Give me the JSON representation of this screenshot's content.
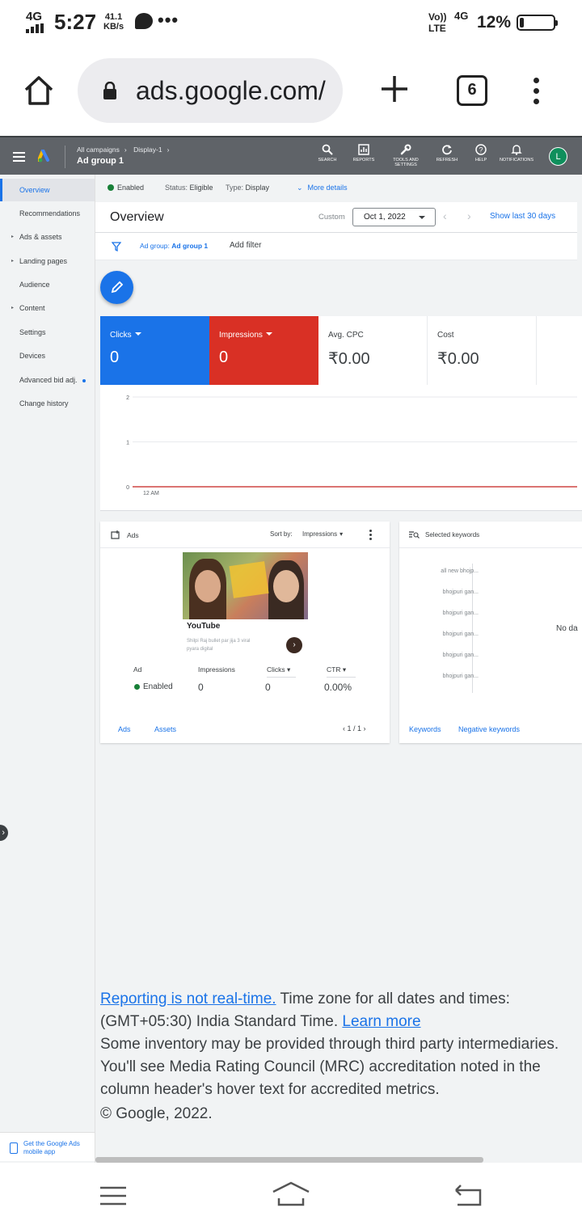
{
  "status_bar": {
    "network": "4G",
    "time": "5:27",
    "speed_value": "41.1",
    "speed_unit": "KB/s",
    "overflow_icon": "more-dots-icon",
    "volte": "Vo))",
    "lte": "LTE",
    "network2": "4G",
    "battery": "12%"
  },
  "browser": {
    "url": "ads.google.com/",
    "tab_count": "6"
  },
  "header": {
    "breadcrumb": [
      "All campaigns",
      "Display-1"
    ],
    "title": "Ad group 1",
    "icons": [
      {
        "label": "SEARCH",
        "icon": "search-icon"
      },
      {
        "label": "REPORTS",
        "icon": "reports-icon"
      },
      {
        "label": "TOOLS AND SETTINGS",
        "icon": "tools-icon"
      },
      {
        "label": "REFRESH",
        "icon": "refresh-icon"
      },
      {
        "label": "HELP",
        "icon": "help-icon"
      },
      {
        "label": "NOTIFICATIONS",
        "icon": "bell-icon"
      }
    ],
    "avatar": "L"
  },
  "nav": {
    "items": [
      {
        "label": "Overview"
      },
      {
        "label": "Recommendations"
      },
      {
        "label": "Ads & assets"
      },
      {
        "label": "Landing pages"
      },
      {
        "label": "Audience"
      },
      {
        "label": "Content"
      },
      {
        "label": "Settings"
      },
      {
        "label": "Devices"
      },
      {
        "label": "Advanced bid adj."
      },
      {
        "label": "Change history"
      }
    ],
    "get_app": "Get the Google Ads mobile app"
  },
  "status_row": {
    "enabled": "Enabled",
    "status_label": "Status:",
    "status_value": "Eligible",
    "type_label": "Type:",
    "type_value": "Display",
    "more_details": "More details"
  },
  "overview": {
    "title": "Overview",
    "custom": "Custom",
    "date": "Oct 1, 2022",
    "show_last": "Show last 30 days"
  },
  "filter": {
    "tag_label": "Ad group:",
    "tag_value": "Ad group 1",
    "add_filter": "Add filter"
  },
  "metrics": [
    {
      "label": "Clicks",
      "value": "0"
    },
    {
      "label": "Impressions",
      "value": "0"
    },
    {
      "label": "Avg. CPC",
      "value": "₹0.00"
    },
    {
      "label": "Cost",
      "value": "₹0.00"
    }
  ],
  "chart_data": {
    "type": "line",
    "x": [
      "12 AM"
    ],
    "series": [
      {
        "values": [
          0
        ]
      }
    ],
    "ylim": [
      0,
      2
    ],
    "yticks": [
      "2",
      "1",
      "0"
    ],
    "line_color": "#c5221f"
  },
  "ads_card": {
    "title": "Ads",
    "sort_by": "Sort by:",
    "sort_value": "Impressions",
    "ad_brand": "YouTube",
    "ad_line1": "Shilpi Raj bullet par jija 3 viral",
    "ad_line2": "pyara digital",
    "columns": [
      "Ad",
      "Impressions",
      "Clicks",
      "CTR"
    ],
    "row": {
      "status": "Enabled",
      "impressions": "0",
      "clicks": "0",
      "ctr": "0.00%"
    },
    "link_ads": "Ads",
    "link_assets": "Assets",
    "pagination": "1 / 1"
  },
  "keywords_card": {
    "title": "Selected keywords",
    "keywords": [
      "all new bhojp...",
      "bhojpuri gan...",
      "bhojpuri gan...",
      "bhojpuri gan...",
      "bhojpuri gan...",
      "bhojpuri gan..."
    ],
    "no_data": "No da",
    "link_keywords": "Keywords",
    "link_negative": "Negative keywords"
  },
  "footer": {
    "link1": "Reporting is not real-time.",
    "text1": " Time zone for all dates and times: (GMT+05:30) India Standard Time. ",
    "link2": "Learn more",
    "text2": "Some inventory may be provided through third party intermediaries.",
    "text3": "You'll see Media Rating Council (MRC) accreditation noted in the column header's hover text for accredited metrics.",
    "text4": "© Google, 2022."
  }
}
